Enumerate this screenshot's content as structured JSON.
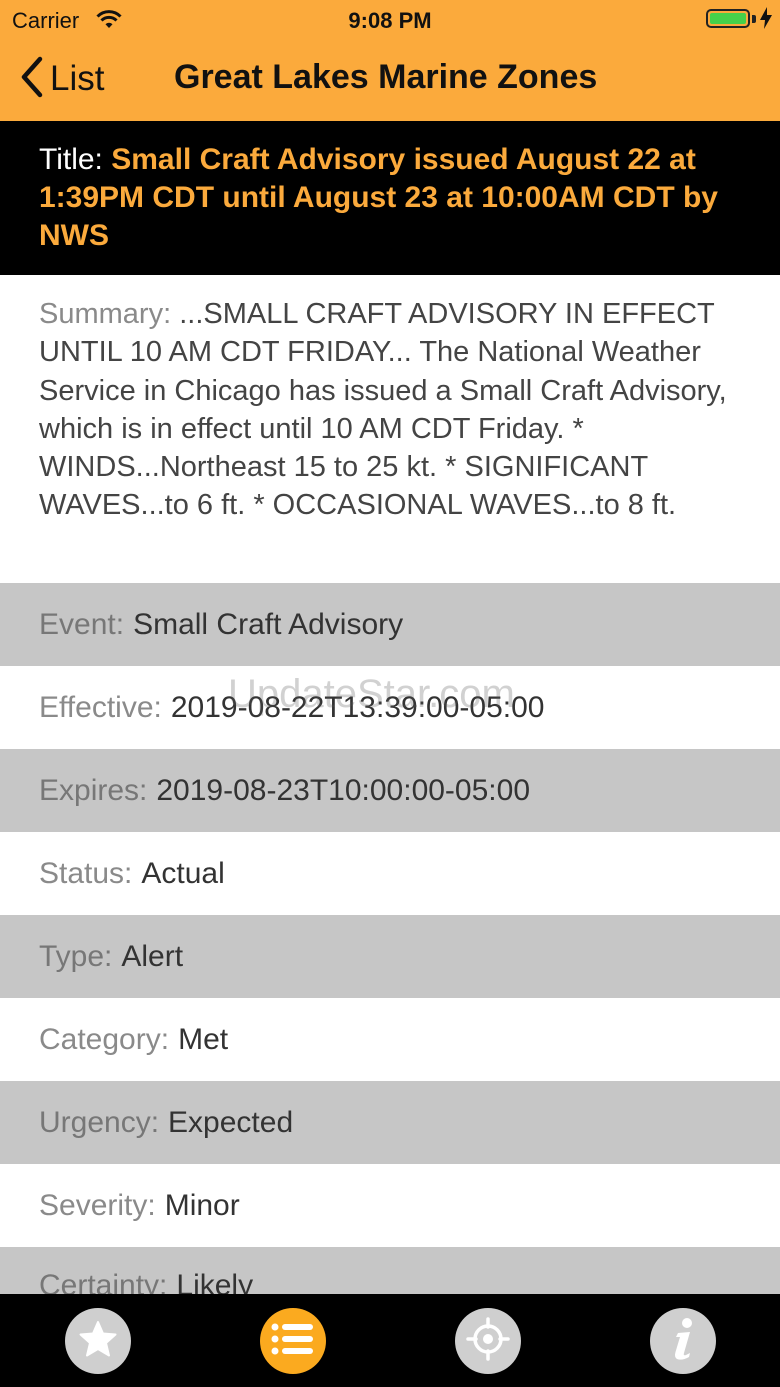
{
  "status_bar": {
    "carrier": "Carrier",
    "time": "9:08 PM",
    "battery_level": 1.0
  },
  "nav": {
    "back_label": "List",
    "title": "Great Lakes Marine Zones"
  },
  "alert": {
    "title_label": "Title:",
    "title_value": "Small Craft Advisory issued August 22 at 1:39PM CDT until August 23 at 10:00AM CDT by NWS",
    "summary_label": "Summary:",
    "summary_value": "...SMALL CRAFT ADVISORY IN EFFECT UNTIL 10 AM CDT FRIDAY... The National Weather Service in Chicago has issued a Small Craft Advisory, which is in effect until 10 AM CDT Friday. * WINDS...Northeast 15 to 25 kt. * SIGNIFICANT WAVES...to 6 ft. * OCCASIONAL WAVES...to 8 ft.",
    "fields": [
      {
        "label": "Event:",
        "value": "Small Craft Advisory"
      },
      {
        "label": "Effective:",
        "value": "2019-08-22T13:39:00-05:00"
      },
      {
        "label": "Expires:",
        "value": "2019-08-23T10:00:00-05:00"
      },
      {
        "label": "Status:",
        "value": "Actual"
      },
      {
        "label": "Type:",
        "value": "Alert"
      },
      {
        "label": "Category:",
        "value": "Met"
      },
      {
        "label": "Urgency:",
        "value": "Expected"
      },
      {
        "label": "Severity:",
        "value": "Minor"
      },
      {
        "label": "Certainty:",
        "value": "Likely"
      }
    ]
  },
  "watermark": "UpdateStar.com",
  "tabs": [
    {
      "icon": "star-icon",
      "active": false
    },
    {
      "icon": "list-icon",
      "active": true
    },
    {
      "icon": "target-icon",
      "active": false
    },
    {
      "icon": "info-icon",
      "active": false
    }
  ],
  "colors": {
    "accent": "#fbaa3c",
    "row_gray": "#c6c6c6",
    "title_bg": "#000000"
  }
}
